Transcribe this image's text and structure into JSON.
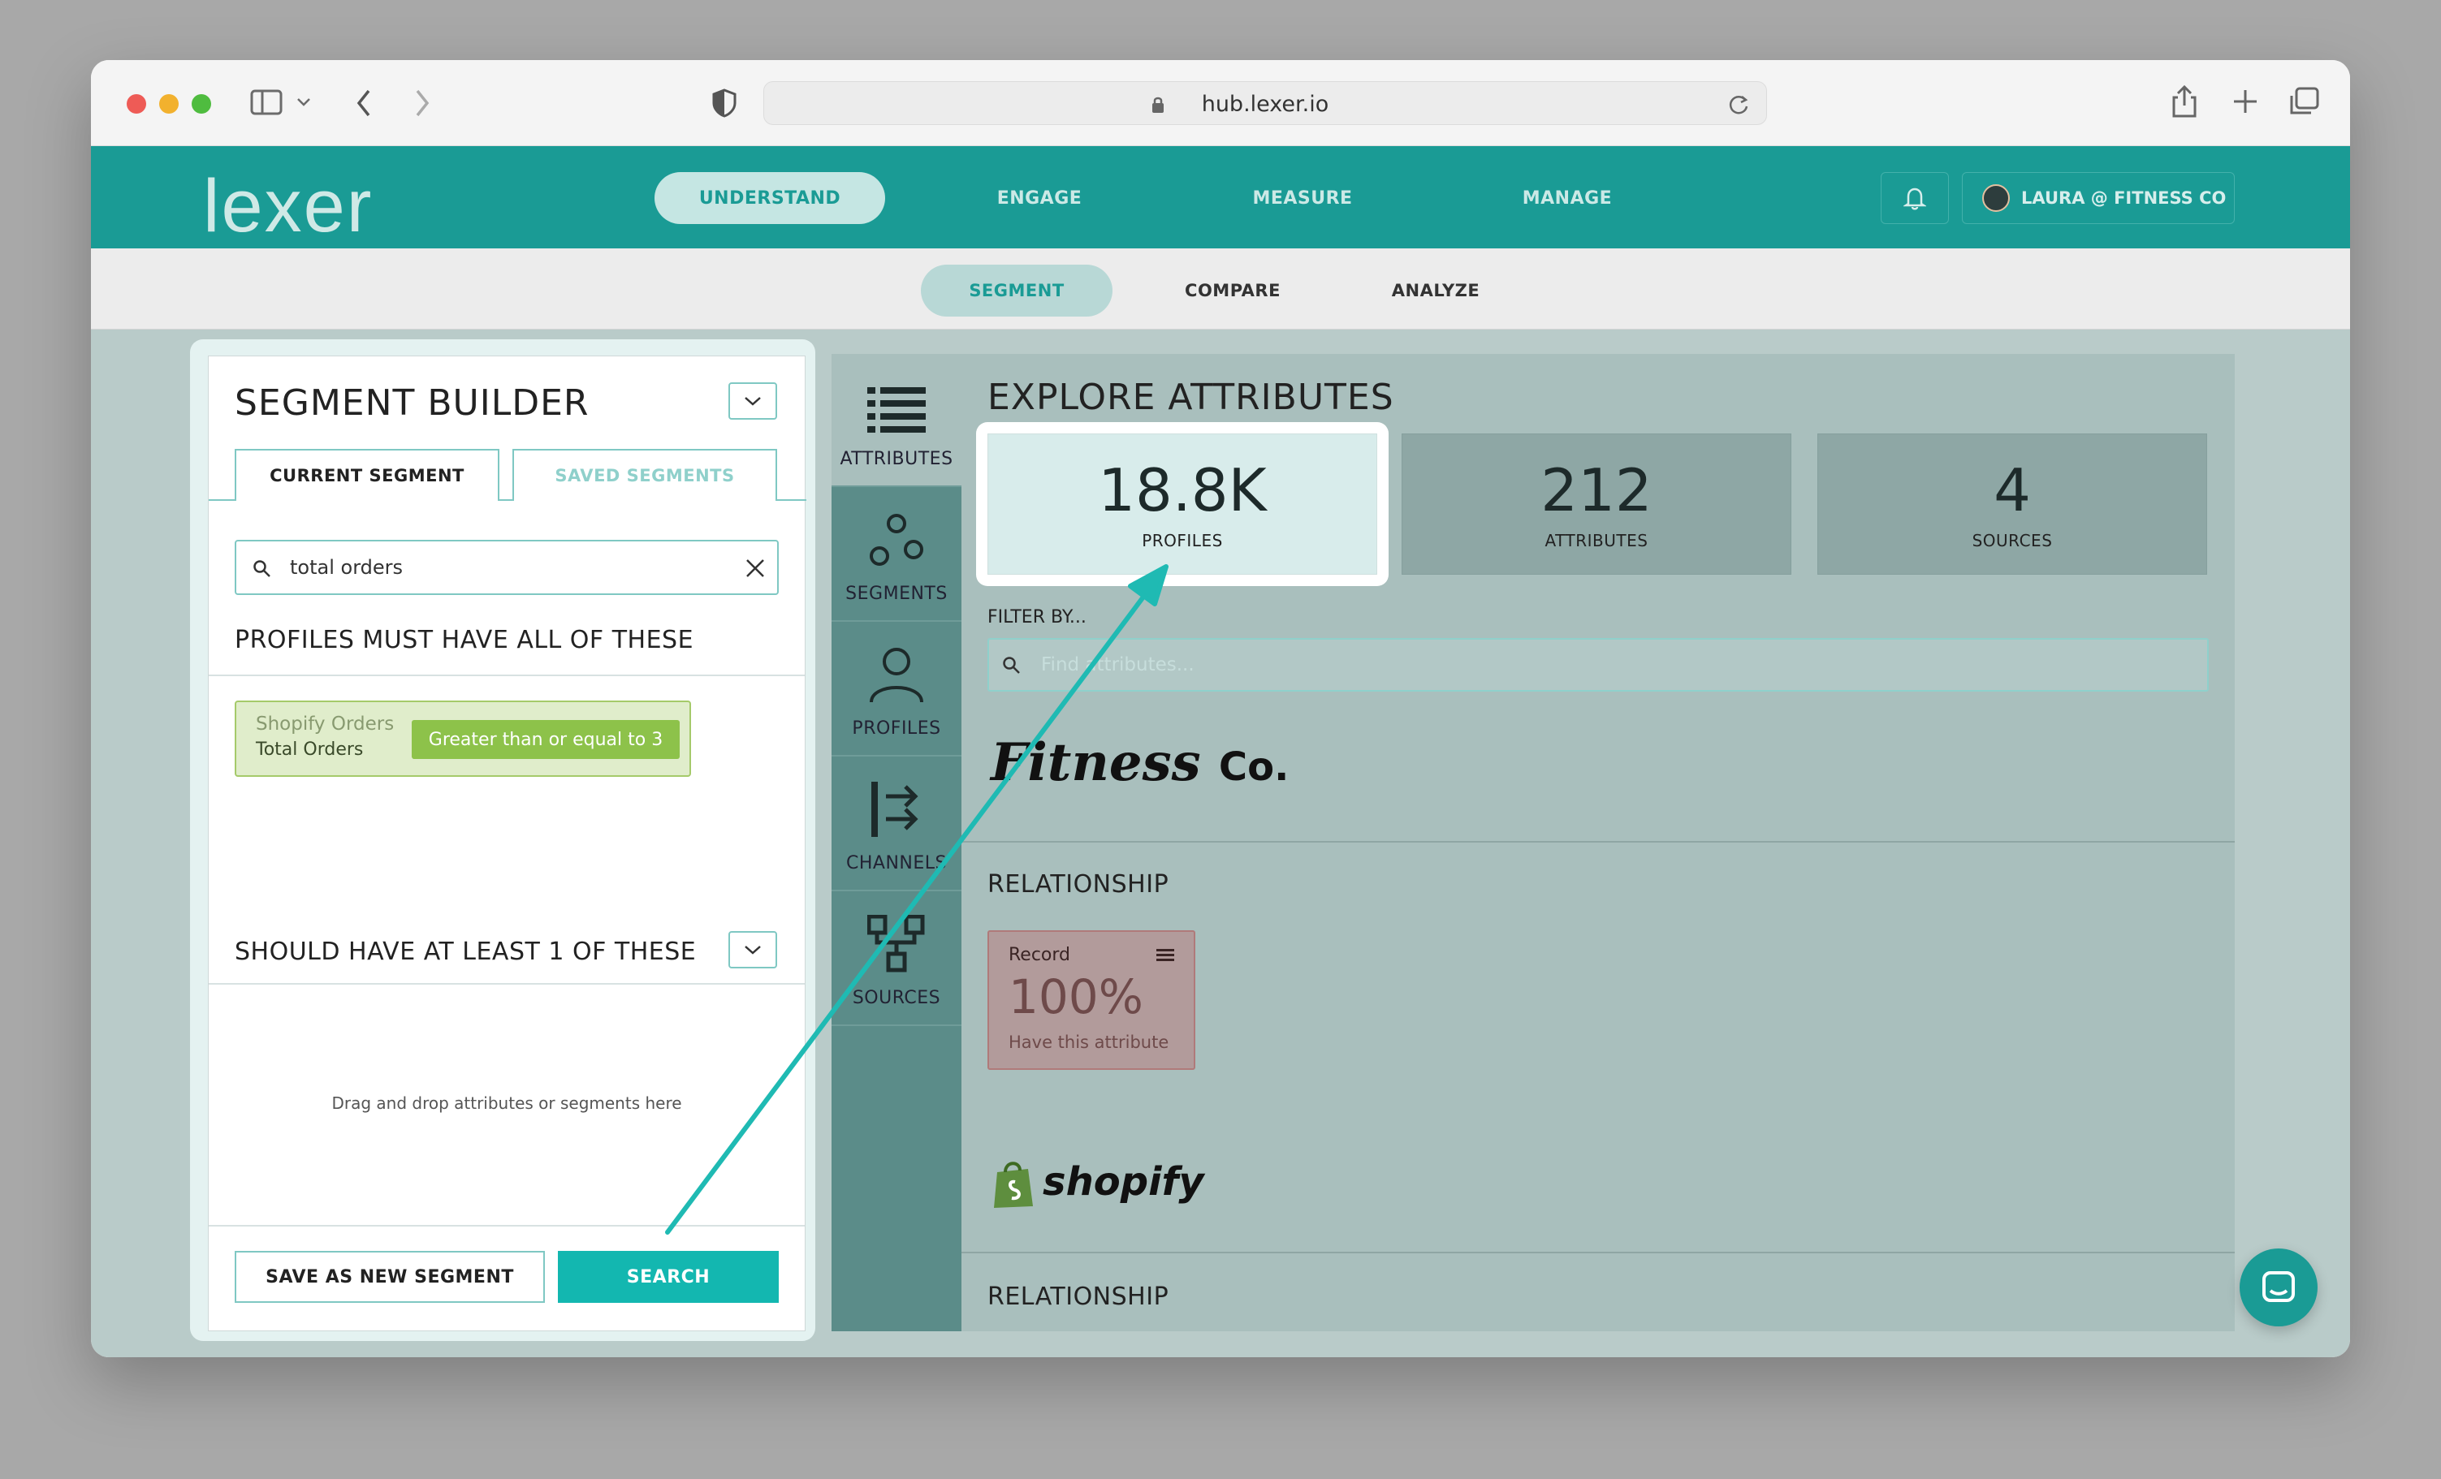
{
  "browser": {
    "url": "hub.lexer.io"
  },
  "app": {
    "logo": "lexer",
    "nav": [
      "UNDERSTAND",
      "ENGAGE",
      "MEASURE",
      "MANAGE"
    ],
    "active_nav": "UNDERSTAND",
    "user": "LAURA @ FITNESS CO",
    "subnav": [
      "SEGMENT",
      "COMPARE",
      "ANALYZE"
    ],
    "active_subnav": "SEGMENT"
  },
  "segment_builder": {
    "title": "SEGMENT BUILDER",
    "tabs": [
      "CURRENT SEGMENT",
      "SAVED SEGMENTS"
    ],
    "search_value": "total orders",
    "must_have_heading": "PROFILES MUST HAVE ALL OF THESE",
    "rule": {
      "source": "Shopify Orders",
      "attribute": "Total Orders",
      "condition": "Greater than or equal to 3"
    },
    "should_have_heading": "SHOULD HAVE AT LEAST 1 OF THESE",
    "dropzone_text": "Drag and drop attributes or segments here",
    "save_button": "SAVE AS NEW SEGMENT",
    "search_button": "SEARCH"
  },
  "sidebar": {
    "items": [
      "ATTRIBUTES",
      "SEGMENTS",
      "PROFILES",
      "CHANNELS",
      "SOURCES"
    ],
    "active": "ATTRIBUTES"
  },
  "explore": {
    "title": "EXPLORE ATTRIBUTES",
    "stats": [
      {
        "value": "18.8K",
        "label": "PROFILES"
      },
      {
        "value": "212",
        "label": "ATTRIBUTES"
      },
      {
        "value": "4",
        "label": "SOURCES"
      }
    ],
    "filter_label": "FILTER BY...",
    "filter_placeholder": "Find attributes...",
    "brand1": "Fitness",
    "brand1_suffix": "Co.",
    "relationship_heading": "RELATIONSHIP",
    "record_card": {
      "title": "Record",
      "value": "100%",
      "subtitle": "Have this attribute"
    },
    "brand2": "shopify",
    "relationship_heading_2": "RELATIONSHIP"
  },
  "colors": {
    "teal": "#1a9b95",
    "search_button": "#13b7b0",
    "rule_condition": "#8dc24a",
    "annotation_arrow": "#1fbab3"
  }
}
